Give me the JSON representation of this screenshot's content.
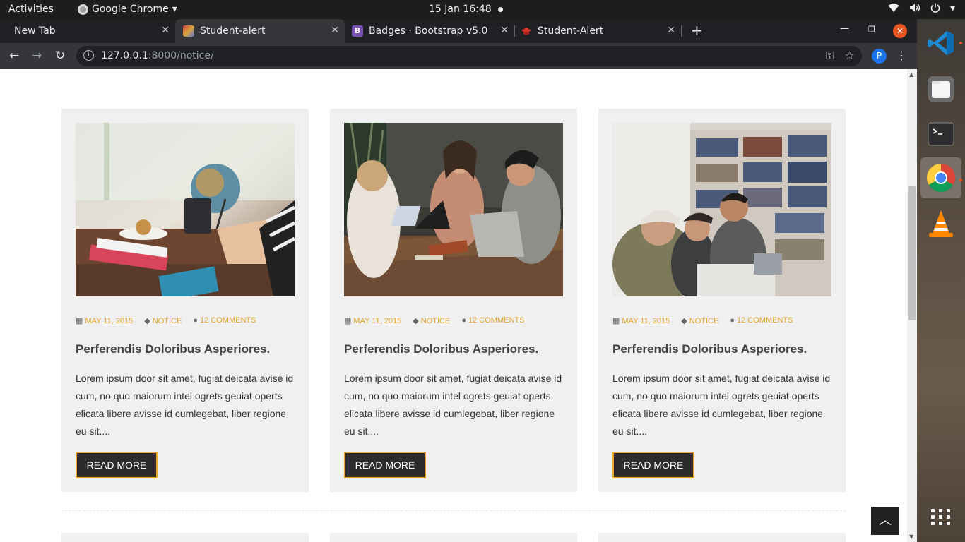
{
  "topbar": {
    "activities": "Activities",
    "app_name": "Google Chrome",
    "clock": "15 Jan  16:48"
  },
  "tabs": [
    {
      "label": "New Tab",
      "active": false
    },
    {
      "label": "Student-alert",
      "active": true
    },
    {
      "label": "Badges · Bootstrap v5.0",
      "active": false
    },
    {
      "label": "Student-Alert",
      "active": false
    }
  ],
  "address": {
    "host": "127.0.0.1",
    "path": ":8000/notice/"
  },
  "profile_initial": "P",
  "cards": [
    {
      "date": "MAY 11, 2015",
      "category": "NOTICE",
      "comments": "12 COMMENTS",
      "title": "Perferendis Doloribus Asperiores.",
      "excerpt": "Lorem ipsum door sit amet, fugiat deicata avise id cum, no quo maiorum intel ogrets geuiat operts elicata libere avisse id cumlegebat, liber regione eu sit....",
      "button": "READ MORE"
    },
    {
      "date": "MAY 11, 2015",
      "category": "NOTICE",
      "comments": "12 COMMENTS",
      "title": "Perferendis Doloribus Asperiores.",
      "excerpt": "Lorem ipsum door sit amet, fugiat deicata avise id cum, no quo maiorum intel ogrets geuiat operts elicata libere avisse id cumlegebat, liber regione eu sit....",
      "button": "READ MORE"
    },
    {
      "date": "MAY 11, 2015",
      "category": "NOTICE",
      "comments": "12 COMMENTS",
      "title": "Perferendis Doloribus Asperiores.",
      "excerpt": "Lorem ipsum door sit amet, fugiat deicata avise id cum, no quo maiorum intel ogrets geuiat operts elicata libere avisse id cumlegebat, liber regione eu sit....",
      "button": "READ MORE"
    }
  ],
  "colors": {
    "accent": "#e3a52b",
    "button_bg": "#2c2c2c",
    "card_bg": "#f0f0f0"
  },
  "icons": {
    "date": "calendar-icon",
    "category": "tag-icon",
    "comments": "comments-icon",
    "scroll_top": "chevron-up-icon"
  }
}
